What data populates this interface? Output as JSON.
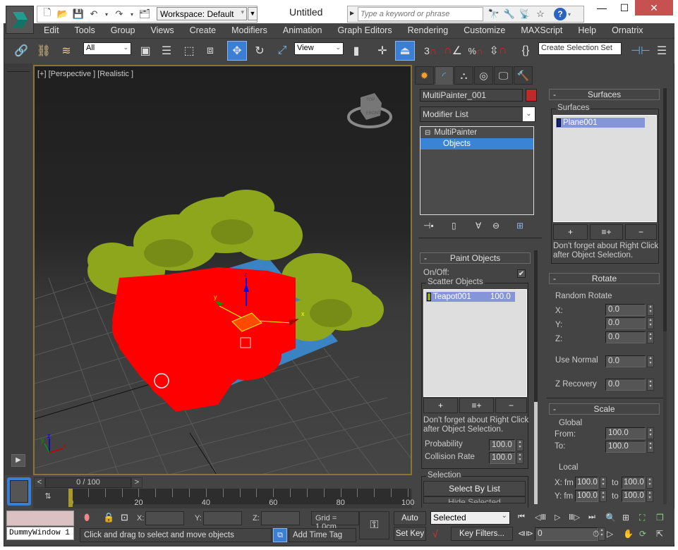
{
  "window": {
    "title": "Untitled",
    "workspace": "Workspace: Default",
    "search_placeholder": "Type a keyword or phrase",
    "minimize": "—",
    "maximize": "☐",
    "close": "✕"
  },
  "menu": [
    "Edit",
    "Tools",
    "Group",
    "Views",
    "Create",
    "Modifiers",
    "Animation",
    "Graph Editors",
    "Rendering",
    "Customize",
    "MAXScript",
    "Help",
    "Ornatrix"
  ],
  "toolbar": {
    "selection_filter": "All",
    "ref_coord": "View",
    "snap_angle_label": "3",
    "selection_set_placeholder": "Create Selection Set"
  },
  "viewport": {
    "label": "[+] [Perspective ] [Realistic ]",
    "viewcube_top": "TOP",
    "viewcube_front": "FRONT",
    "gizmo_axes": {
      "x": "x",
      "y": "y",
      "z": "z"
    },
    "colors": {
      "selected": "#ff0000",
      "scatter": "#8ea61c",
      "surface": "#3a84c4",
      "frame": "#8b7535"
    }
  },
  "time_slider": {
    "position": "0 / 100",
    "prev": "<",
    "next": ">",
    "current_frame": 0,
    "total_frames": 100
  },
  "trackbar": {
    "labels": [
      "0",
      "20",
      "40",
      "60",
      "80",
      "100"
    ]
  },
  "status": {
    "maxscript_listener": "DummyWindow 1",
    "coord_x_label": "X:",
    "coord_y_label": "Y:",
    "coord_z_label": "Z:",
    "coord_x": "",
    "coord_y": "",
    "coord_z": "",
    "grid": "Grid = 1.0cm",
    "prompt": "Click and drag to select and move objects",
    "add_time_tag": "Add Time Tag"
  },
  "anim_controls": {
    "auto_key": "Auto Key",
    "set_key": "Set Key",
    "key_mode": "Selected",
    "key_filters": "Key Filters...",
    "frame": "0"
  },
  "command_panel": {
    "object_name": "MultiPainter_001",
    "object_color": "#c0282a",
    "modifier_list": "Modifier List",
    "stack": [
      {
        "label": "MultiPainter",
        "expander": "⊟"
      },
      {
        "label": "Objects",
        "selected": true
      }
    ]
  },
  "paint_objects": {
    "title": "Paint Objects",
    "collapse": "-",
    "onoff_label": "On/Off:",
    "onoff_checked": true,
    "scatter_group": "Scatter Objects",
    "items": [
      {
        "name": "Teapot001",
        "value": "100.0",
        "color": "#8ea61c"
      }
    ],
    "add": "+",
    "add_list": "≡+",
    "remove": "−",
    "hint": "Don't forget about Right Click after Object Selection.",
    "probability_label": "Probability",
    "probability": "100.0",
    "collision_label": "Collision Rate",
    "collision": "100.0",
    "selection_group": "Selection",
    "select_by_list": "Select By List",
    "hide_selected": "Hide Selected"
  },
  "surfaces": {
    "title": "Surfaces",
    "collapse": "-",
    "group": "Surfaces",
    "items": [
      {
        "name": "Plane001",
        "color": "#0b2a7a"
      }
    ],
    "add": "+",
    "add_list": "≡+",
    "remove": "−",
    "hint": "Don't forget about Right Click after Object Selection."
  },
  "rotate": {
    "title": "Rotate",
    "collapse": "-",
    "random_label": "Random Rotate",
    "x_label": "X:",
    "x": "0.0",
    "y_label": "Y:",
    "y": "0.0",
    "z_label": "Z:",
    "z": "0.0",
    "use_normal_label": "Use Normal",
    "use_normal": "0.0",
    "z_recovery_label": "Z Recovery",
    "z_recovery": "0.0"
  },
  "scale": {
    "title": "Scale",
    "collapse": "-",
    "global_label": "Global",
    "from_label": "From:",
    "from": "100.0",
    "to_label": "To:",
    "to": "100.0",
    "local_label": "Local",
    "x_label": "X: fm",
    "x_from": "100.0",
    "x_to_label": "to",
    "x_to": "100.0",
    "y_label": "Y: fm",
    "y_from": "100.0",
    "y_to_label": "to",
    "y_to": "100.0"
  }
}
